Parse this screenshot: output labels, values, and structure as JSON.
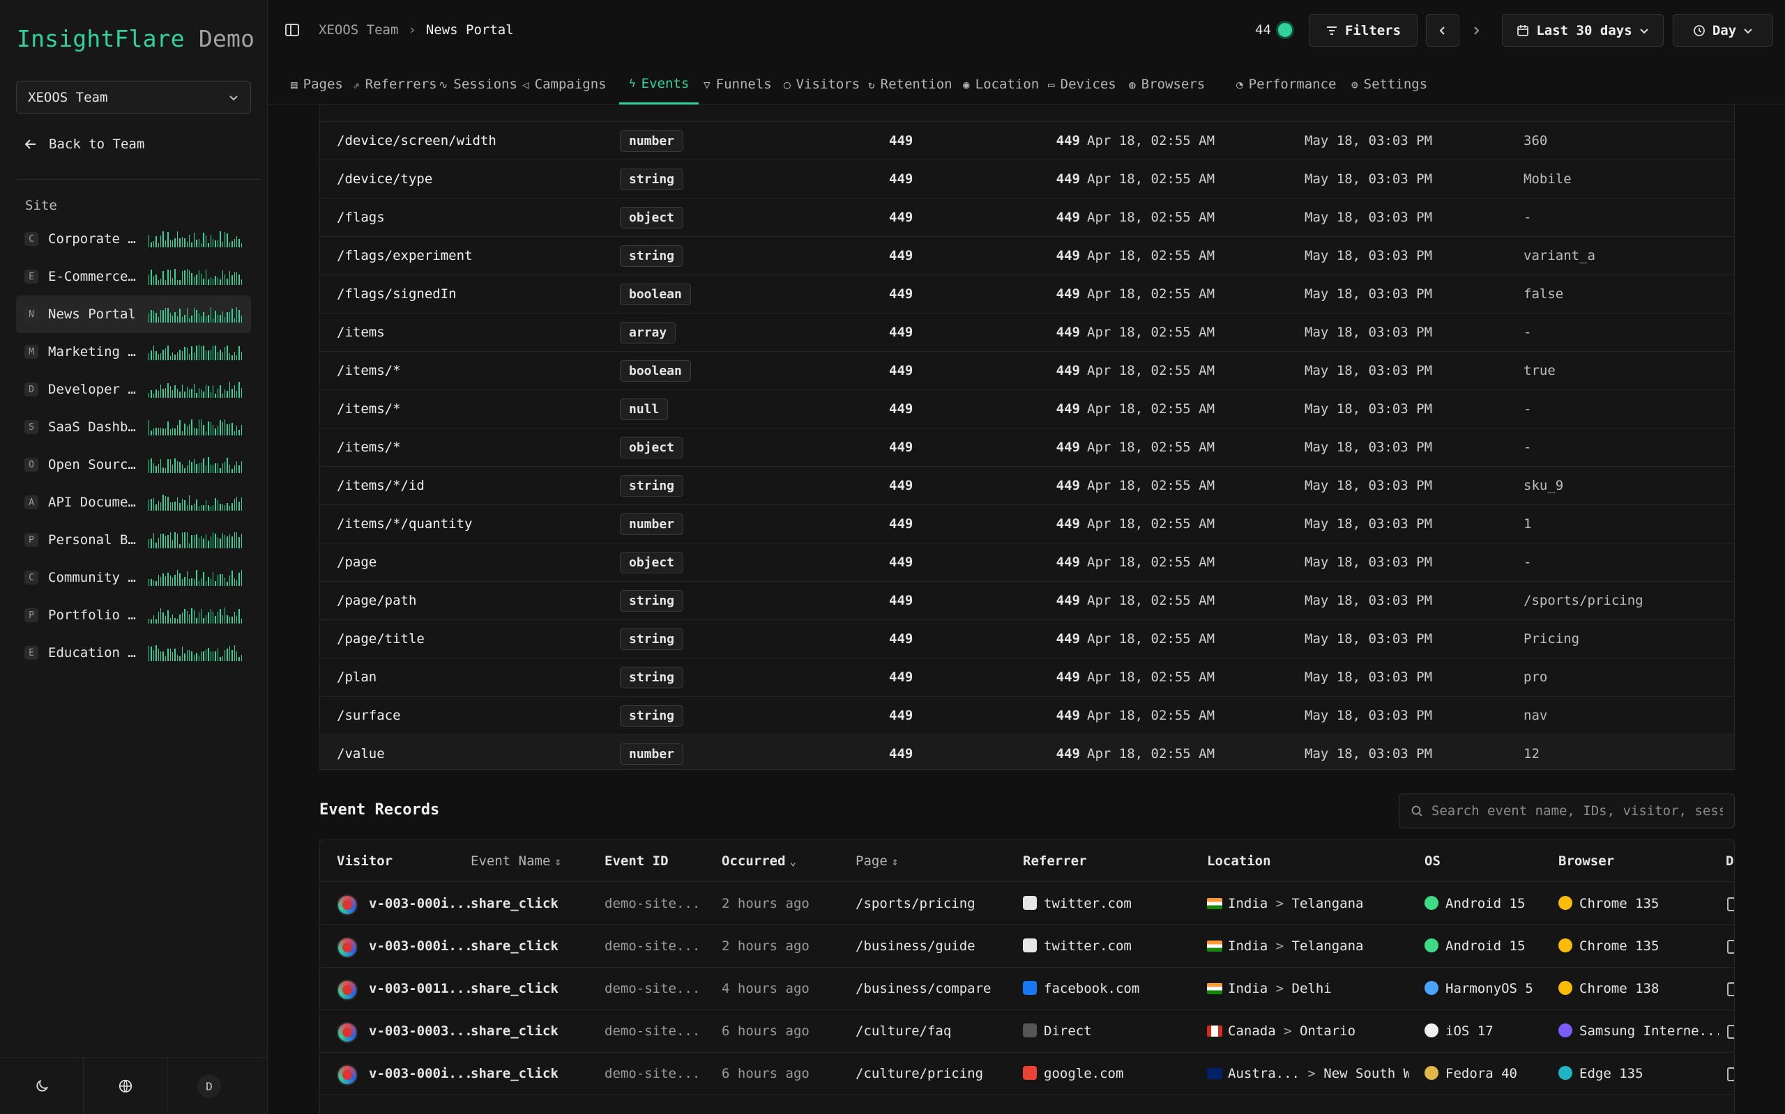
{
  "sidebar": {
    "brand_accent": "InsightFlare",
    "brand_rest": "Demo",
    "team": "XEOOS Team",
    "back_label": "Back to Team",
    "site_heading": "Site",
    "sites": [
      {
        "letter": "C",
        "name": "Corporate W..."
      },
      {
        "letter": "E",
        "name": "E-Commerce ..."
      },
      {
        "letter": "N",
        "name": "News Portal"
      },
      {
        "letter": "M",
        "name": "Marketing L..."
      },
      {
        "letter": "D",
        "name": "Developer D..."
      },
      {
        "letter": "S",
        "name": "SaaS Dashbo..."
      },
      {
        "letter": "O",
        "name": "Open Source..."
      },
      {
        "letter": "A",
        "name": "API Documen..."
      },
      {
        "letter": "P",
        "name": "Personal Bl..."
      },
      {
        "letter": "C",
        "name": "Community F..."
      },
      {
        "letter": "P",
        "name": "Portfolio S..."
      },
      {
        "letter": "E",
        "name": "Education P..."
      }
    ],
    "avatar_letter": "D"
  },
  "header": {
    "crumb_team": "XEOOS Team",
    "crumb_site": "News Portal",
    "live_count": "44",
    "filters_label": "Filters",
    "range_label": "Last 30 days",
    "granularity_label": "Day"
  },
  "tabs": [
    "Pages",
    "Referrers",
    "Sessions",
    "Campaigns",
    "Events",
    "Funnels",
    "Visitors",
    "Retention",
    "Location",
    "Devices",
    "Browsers",
    "Performance",
    "Settings"
  ],
  "active_tab": "Events",
  "properties": [
    {
      "path": "/device/screen/width",
      "type": "number",
      "events": "449",
      "count": "449",
      "first": "Apr 18, 02:55 AM",
      "last": "May 18, 03:03 PM",
      "example": "360"
    },
    {
      "path": "/device/type",
      "type": "string",
      "events": "449",
      "count": "449",
      "first": "Apr 18, 02:55 AM",
      "last": "May 18, 03:03 PM",
      "example": "Mobile"
    },
    {
      "path": "/flags",
      "type": "object",
      "events": "449",
      "count": "449",
      "first": "Apr 18, 02:55 AM",
      "last": "May 18, 03:03 PM",
      "example": "-"
    },
    {
      "path": "/flags/experiment",
      "type": "string",
      "events": "449",
      "count": "449",
      "first": "Apr 18, 02:55 AM",
      "last": "May 18, 03:03 PM",
      "example": "variant_a"
    },
    {
      "path": "/flags/signedIn",
      "type": "boolean",
      "events": "449",
      "count": "449",
      "first": "Apr 18, 02:55 AM",
      "last": "May 18, 03:03 PM",
      "example": "false"
    },
    {
      "path": "/items",
      "type": "array",
      "events": "449",
      "count": "449",
      "first": "Apr 18, 02:55 AM",
      "last": "May 18, 03:03 PM",
      "example": "-"
    },
    {
      "path": "/items/*",
      "type": "boolean",
      "events": "449",
      "count": "449",
      "first": "Apr 18, 02:55 AM",
      "last": "May 18, 03:03 PM",
      "example": "true"
    },
    {
      "path": "/items/*",
      "type": "null",
      "events": "449",
      "count": "449",
      "first": "Apr 18, 02:55 AM",
      "last": "May 18, 03:03 PM",
      "example": "-"
    },
    {
      "path": "/items/*",
      "type": "object",
      "events": "449",
      "count": "449",
      "first": "Apr 18, 02:55 AM",
      "last": "May 18, 03:03 PM",
      "example": "-"
    },
    {
      "path": "/items/*/id",
      "type": "string",
      "events": "449",
      "count": "449",
      "first": "Apr 18, 02:55 AM",
      "last": "May 18, 03:03 PM",
      "example": "sku_9"
    },
    {
      "path": "/items/*/quantity",
      "type": "number",
      "events": "449",
      "count": "449",
      "first": "Apr 18, 02:55 AM",
      "last": "May 18, 03:03 PM",
      "example": "1"
    },
    {
      "path": "/page",
      "type": "object",
      "events": "449",
      "count": "449",
      "first": "Apr 18, 02:55 AM",
      "last": "May 18, 03:03 PM",
      "example": "-"
    },
    {
      "path": "/page/path",
      "type": "string",
      "events": "449",
      "count": "449",
      "first": "Apr 18, 02:55 AM",
      "last": "May 18, 03:03 PM",
      "example": "/sports/pricing"
    },
    {
      "path": "/page/title",
      "type": "string",
      "events": "449",
      "count": "449",
      "first": "Apr 18, 02:55 AM",
      "last": "May 18, 03:03 PM",
      "example": "Pricing"
    },
    {
      "path": "/plan",
      "type": "string",
      "events": "449",
      "count": "449",
      "first": "Apr 18, 02:55 AM",
      "last": "May 18, 03:03 PM",
      "example": "pro"
    },
    {
      "path": "/surface",
      "type": "string",
      "events": "449",
      "count": "449",
      "first": "Apr 18, 02:55 AM",
      "last": "May 18, 03:03 PM",
      "example": "nav"
    },
    {
      "path": "/value",
      "type": "number",
      "events": "449",
      "count": "449",
      "first": "Apr 18, 02:55 AM",
      "last": "May 18, 03:03 PM",
      "example": "12"
    }
  ],
  "records": {
    "title": "Event Records",
    "search_placeholder": "Search event name, IDs, visitor, sessi",
    "columns": [
      "Visitor",
      "Event Name",
      "Event ID",
      "Occurred",
      "Page",
      "Referrer",
      "Location",
      "OS",
      "Browser",
      "D"
    ],
    "rows": [
      {
        "visitor": "v-003-000i...",
        "event": "share_click",
        "id": "demo-site...",
        "occurred": "2 hours ago",
        "page": "/sports/pricing",
        "referrer": "twitter.com",
        "country": "India",
        "region": "Telangana",
        "os": "Android 15",
        "browser": "Chrome 135"
      },
      {
        "visitor": "v-003-000i...",
        "event": "share_click",
        "id": "demo-site...",
        "occurred": "2 hours ago",
        "page": "/business/guide",
        "referrer": "twitter.com",
        "country": "India",
        "region": "Telangana",
        "os": "Android 15",
        "browser": "Chrome 135"
      },
      {
        "visitor": "v-003-0011...",
        "event": "share_click",
        "id": "demo-site...",
        "occurred": "4 hours ago",
        "page": "/business/compare",
        "referrer": "facebook.com",
        "country": "India",
        "region": "Delhi",
        "os": "HarmonyOS 5",
        "browser": "Chrome 138"
      },
      {
        "visitor": "v-003-0003...",
        "event": "share_click",
        "id": "demo-site...",
        "occurred": "6 hours ago",
        "page": "/culture/faq",
        "referrer": "Direct",
        "country": "Canada",
        "region": "Ontario",
        "os": "iOS 17",
        "browser": "Samsung Interne..."
      },
      {
        "visitor": "v-003-000i...",
        "event": "share_click",
        "id": "demo-site...",
        "occurred": "6 hours ago",
        "page": "/culture/pricing",
        "referrer": "google.com",
        "country": "Austra...",
        "region": "New South Wale",
        "os": "Fedora 40",
        "browser": "Edge 135"
      }
    ]
  },
  "colors": {
    "accent": "#2fd39b",
    "background": "#111111"
  }
}
